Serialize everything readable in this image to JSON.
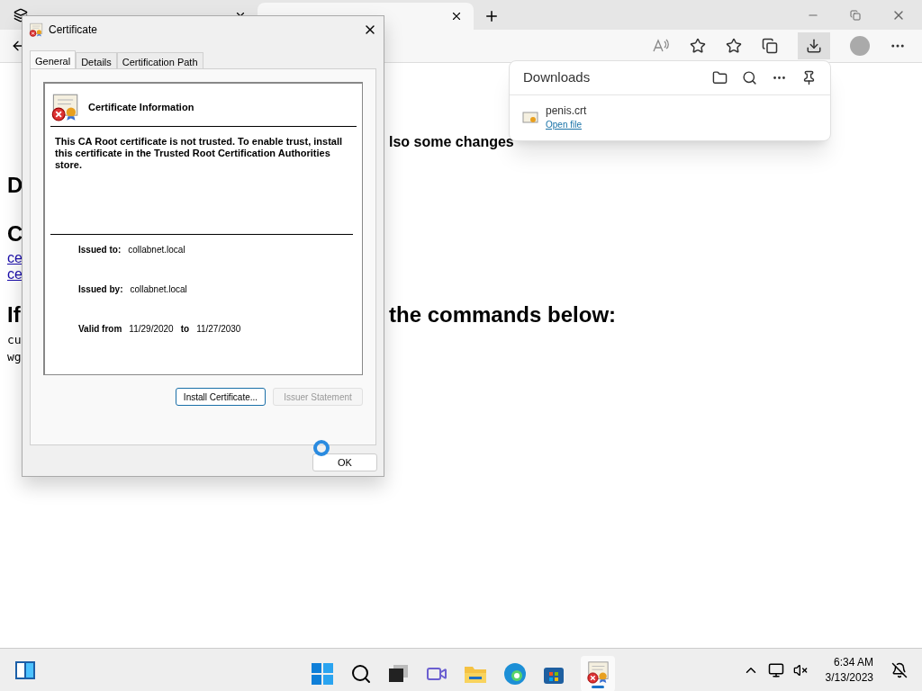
{
  "browser": {
    "page": [
      {
        "kind": "p",
        "right": "lso some changes"
      },
      {
        "kind": "h2",
        "left": "D"
      },
      {
        "kind": "h2",
        "left": "C"
      },
      {
        "kind": "link",
        "left": "ce"
      },
      {
        "kind": "link",
        "left": "ce"
      },
      {
        "kind": "h2",
        "left": "If",
        "right": "the commands below:"
      },
      {
        "kind": "code",
        "left": "cu"
      },
      {
        "kind": "code",
        "left": "wg"
      }
    ]
  },
  "downloads": {
    "title": "Downloads",
    "items": [
      {
        "name": "penis.crt",
        "action": "Open file"
      }
    ]
  },
  "dialog": {
    "title": "Certificate",
    "tabs": [
      {
        "label": "General",
        "selected": true
      },
      {
        "label": "Details",
        "selected": false
      },
      {
        "label": "Certification Path",
        "selected": false
      }
    ],
    "heading": "Certificate Information",
    "message": "This CA Root certificate is not trusted. To enable trust, install this certificate in the Trusted Root Certification Authorities store.",
    "issued_to_label": "Issued to:",
    "issued_to": "collabnet.local",
    "issued_by_label": "Issued by:",
    "issued_by": "collabnet.local",
    "valid_from_label": "Valid from",
    "valid_from": "11/29/2020",
    "to_label": "to",
    "valid_to": "11/27/2030",
    "buttons": [
      {
        "label": "Install Certificate...",
        "disabled": false
      },
      {
        "label": "Issuer Statement",
        "disabled": true
      }
    ],
    "ok": "OK"
  },
  "taskbar": {
    "time": "6:34 AM",
    "date": "3/13/2023"
  }
}
